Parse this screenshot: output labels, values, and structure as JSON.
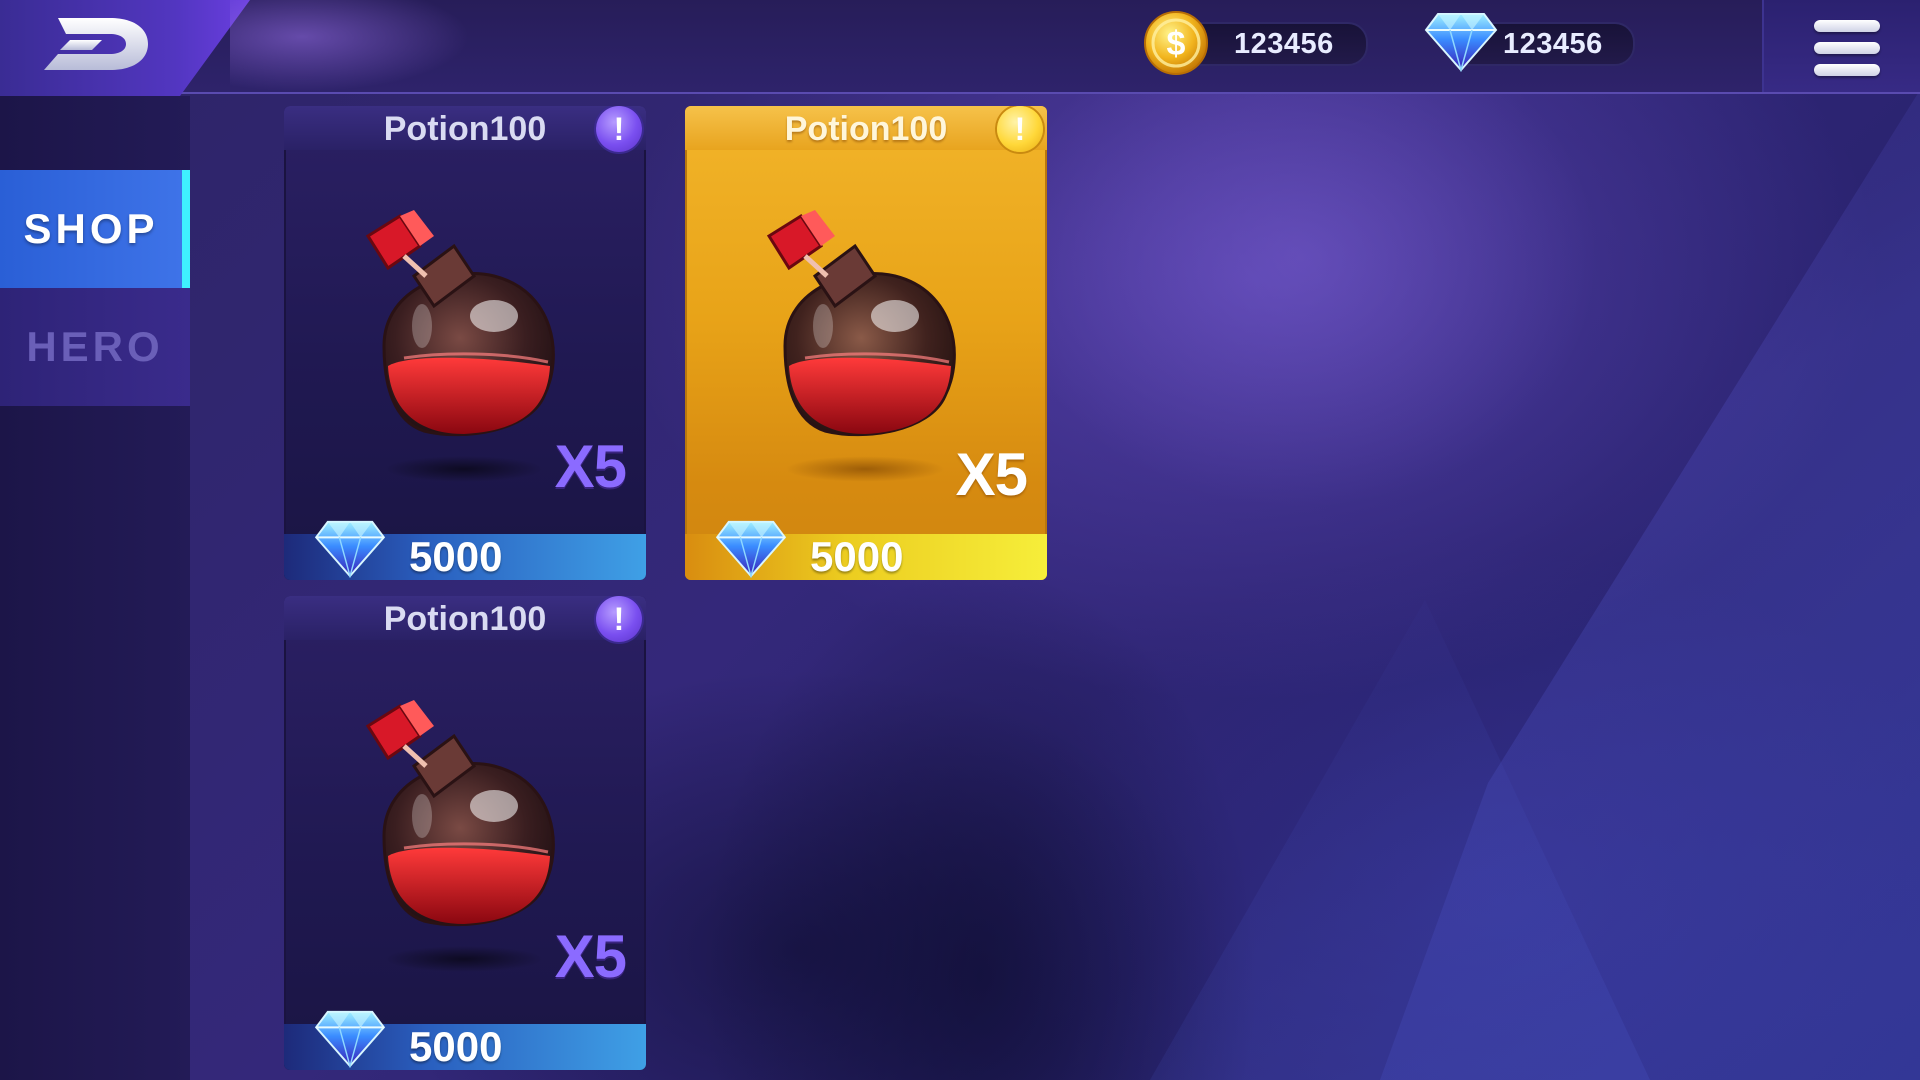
{
  "currencies": {
    "coins": {
      "amount": "123456",
      "icon": "coin-icon"
    },
    "gems": {
      "amount": "123456",
      "icon": "gem-icon"
    }
  },
  "nav": {
    "shop_label": "SHOP",
    "hero_label": "HERO"
  },
  "items": [
    {
      "title": "Potion100",
      "quantity": "X5",
      "price": "5000",
      "highlighted": false
    },
    {
      "title": "Potion100",
      "quantity": "X5",
      "price": "5000",
      "highlighted": true
    },
    {
      "title": "Potion100",
      "quantity": "X5",
      "price": "5000",
      "highlighted": false
    }
  ],
  "colors": {
    "accent_cyan": "#3ff0ff",
    "shop_tab": "#3e73e8",
    "gold": "#f2b52a",
    "quantity_purple": "#8b6bff"
  }
}
